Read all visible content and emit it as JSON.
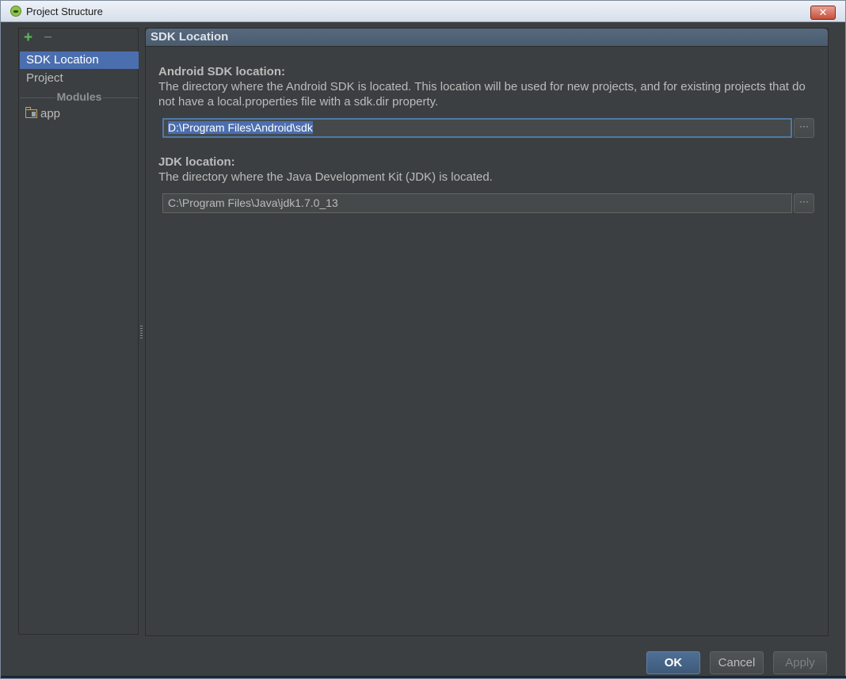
{
  "window": {
    "title": "Project Structure",
    "close_label": "✕"
  },
  "sidebar": {
    "add_label": "+",
    "remove_label": "−",
    "items": [
      {
        "label": "SDK Location",
        "selected": true
      },
      {
        "label": "Project",
        "selected": false
      }
    ],
    "modules_header": "Modules",
    "modules": [
      {
        "label": "app",
        "icon": "module-folder-icon"
      }
    ]
  },
  "main": {
    "header": "SDK Location",
    "android_sdk": {
      "label": "Android SDK location:",
      "description": "The directory where the Android SDK is located. This location will be used for new projects, and for existing projects that do not have a local.properties file with a sdk.dir property.",
      "value": "D:\\Program Files\\Android\\sdk",
      "browse_label": "···"
    },
    "jdk": {
      "label": "JDK location:",
      "description": "The directory where the Java Development Kit (JDK) is located.",
      "value": "C:\\Program Files\\Java\\jdk1.7.0_13",
      "browse_label": "···"
    }
  },
  "footer": {
    "ok_label": "OK",
    "cancel_label": "Cancel",
    "apply_label": "Apply"
  },
  "colors": {
    "selection": "#4b6eaf",
    "background": "#3c3f41",
    "add_icon": "#5cb85c"
  }
}
